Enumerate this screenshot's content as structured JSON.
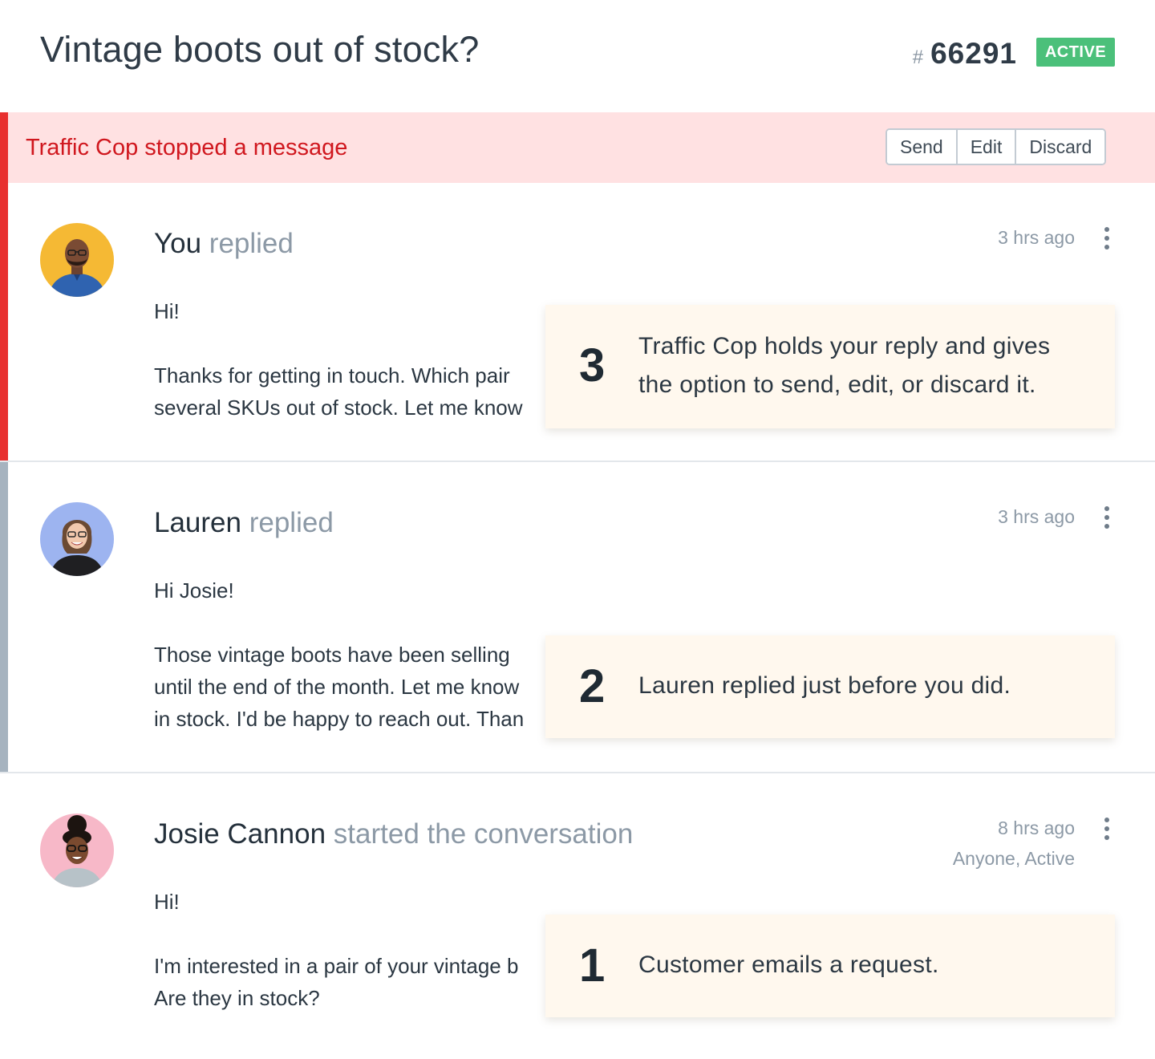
{
  "header": {
    "subject": "Vintage boots out of stock?",
    "ticket_hash": "#",
    "ticket_number": "66291",
    "status": "ACTIVE",
    "status_color": "#4bc07a"
  },
  "banner": {
    "message": "Traffic Cop stopped a message",
    "actions": [
      "Send",
      "Edit",
      "Discard"
    ],
    "background": "#ffe1e2",
    "text_color": "#d0171e"
  },
  "threads": [
    {
      "author": "You",
      "action": "replied",
      "time": "3 hrs ago",
      "body": [
        "Hi!",
        "Thanks for getting in touch. Which pair",
        "several SKUs out of stock. Let me know"
      ]
    },
    {
      "author": "Lauren",
      "action": "replied",
      "time": "3 hrs ago",
      "body": [
        "Hi Josie!",
        "Those vintage boots have been selling",
        "until the end of the month. Let me know",
        "in stock. I'd be happy to reach out. Than"
      ]
    },
    {
      "author": "Josie Cannon",
      "action": "started the conversation",
      "time": "8 hrs ago",
      "meta": "Anyone, Active",
      "body": [
        "Hi!",
        "I'm interested in a pair of your vintage b",
        "Are they in stock?"
      ]
    }
  ],
  "callouts": [
    {
      "number": "3",
      "lines": [
        "Traffic Cop holds your reply and gives",
        "the option to send, edit, or discard it."
      ]
    },
    {
      "number": "2",
      "lines": [
        "Lauren replied just before you did."
      ]
    },
    {
      "number": "1",
      "lines": [
        "Customer emails a request."
      ]
    }
  ]
}
